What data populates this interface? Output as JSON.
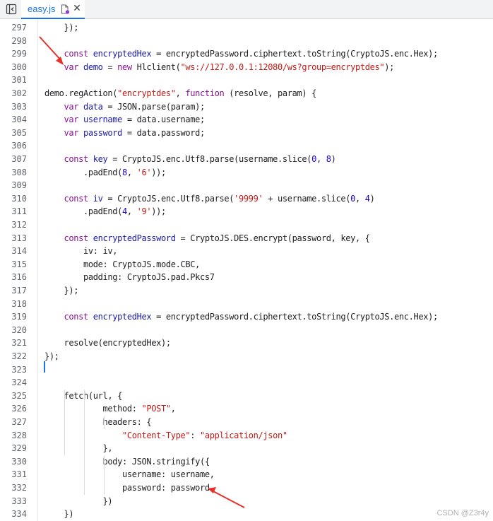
{
  "tab": {
    "label": "easy.js",
    "close_glyph": "✕",
    "file_icon": "file-modified-icon"
  },
  "lines": [
    {
      "n": "297",
      "text": "    });"
    },
    {
      "n": "298",
      "text": ""
    },
    {
      "n": "299",
      "text": "    const encryptedHex = encryptedPassword.ciphertext.toString(CryptoJS.enc.Hex);"
    },
    {
      "n": "300",
      "text": "    var demo = new Hlclient(\"ws://127.0.0.1:12080/ws?group=encryptdes\");"
    },
    {
      "n": "301",
      "text": ""
    },
    {
      "n": "302",
      "text": "demo.regAction(\"encryptdes\", function (resolve, param) {"
    },
    {
      "n": "303",
      "text": "    var data = JSON.parse(param);"
    },
    {
      "n": "304",
      "text": "    var username = data.username;"
    },
    {
      "n": "305",
      "text": "    var password = data.password;"
    },
    {
      "n": "306",
      "text": ""
    },
    {
      "n": "307",
      "text": "    const key = CryptoJS.enc.Utf8.parse(username.slice(0, 8)"
    },
    {
      "n": "308",
      "text": "        .padEnd(8, '6'));"
    },
    {
      "n": "309",
      "text": ""
    },
    {
      "n": "310",
      "text": "    const iv = CryptoJS.enc.Utf8.parse('9999' + username.slice(0, 4)"
    },
    {
      "n": "311",
      "text": "        .padEnd(4, '9'));"
    },
    {
      "n": "312",
      "text": ""
    },
    {
      "n": "313",
      "text": "    const encryptedPassword = CryptoJS.DES.encrypt(password, key, {"
    },
    {
      "n": "314",
      "text": "        iv: iv,"
    },
    {
      "n": "315",
      "text": "        mode: CryptoJS.mode.CBC,"
    },
    {
      "n": "316",
      "text": "        padding: CryptoJS.pad.Pkcs7"
    },
    {
      "n": "317",
      "text": "    });"
    },
    {
      "n": "318",
      "text": ""
    },
    {
      "n": "319",
      "text": "    const encryptedHex = encryptedPassword.ciphertext.toString(CryptoJS.enc.Hex);"
    },
    {
      "n": "320",
      "text": ""
    },
    {
      "n": "321",
      "text": "    resolve(encryptedHex);"
    },
    {
      "n": "322",
      "text": "});"
    },
    {
      "n": "323",
      "text": ""
    },
    {
      "n": "324",
      "text": ""
    },
    {
      "n": "325",
      "text": "    fetch(url, {"
    },
    {
      "n": "326",
      "text": "            method: \"POST\","
    },
    {
      "n": "327",
      "text": "            headers: {"
    },
    {
      "n": "328",
      "text": "                \"Content-Type\": \"application/json\""
    },
    {
      "n": "329",
      "text": "            },"
    },
    {
      "n": "330",
      "text": "            body: JSON.stringify({"
    },
    {
      "n": "331",
      "text": "                username: username,"
    },
    {
      "n": "332",
      "text": "                password: password"
    },
    {
      "n": "333",
      "text": "            })"
    },
    {
      "n": "334",
      "text": "    })"
    }
  ],
  "watermark": "CSDN @Z3r4y",
  "colors": {
    "keyword": "#881391",
    "definition": "#1a1aa6",
    "string": "#c41a16",
    "number": "#1c00cf",
    "accent": "#1a73e8",
    "annotation_arrow": "#e8302a"
  }
}
